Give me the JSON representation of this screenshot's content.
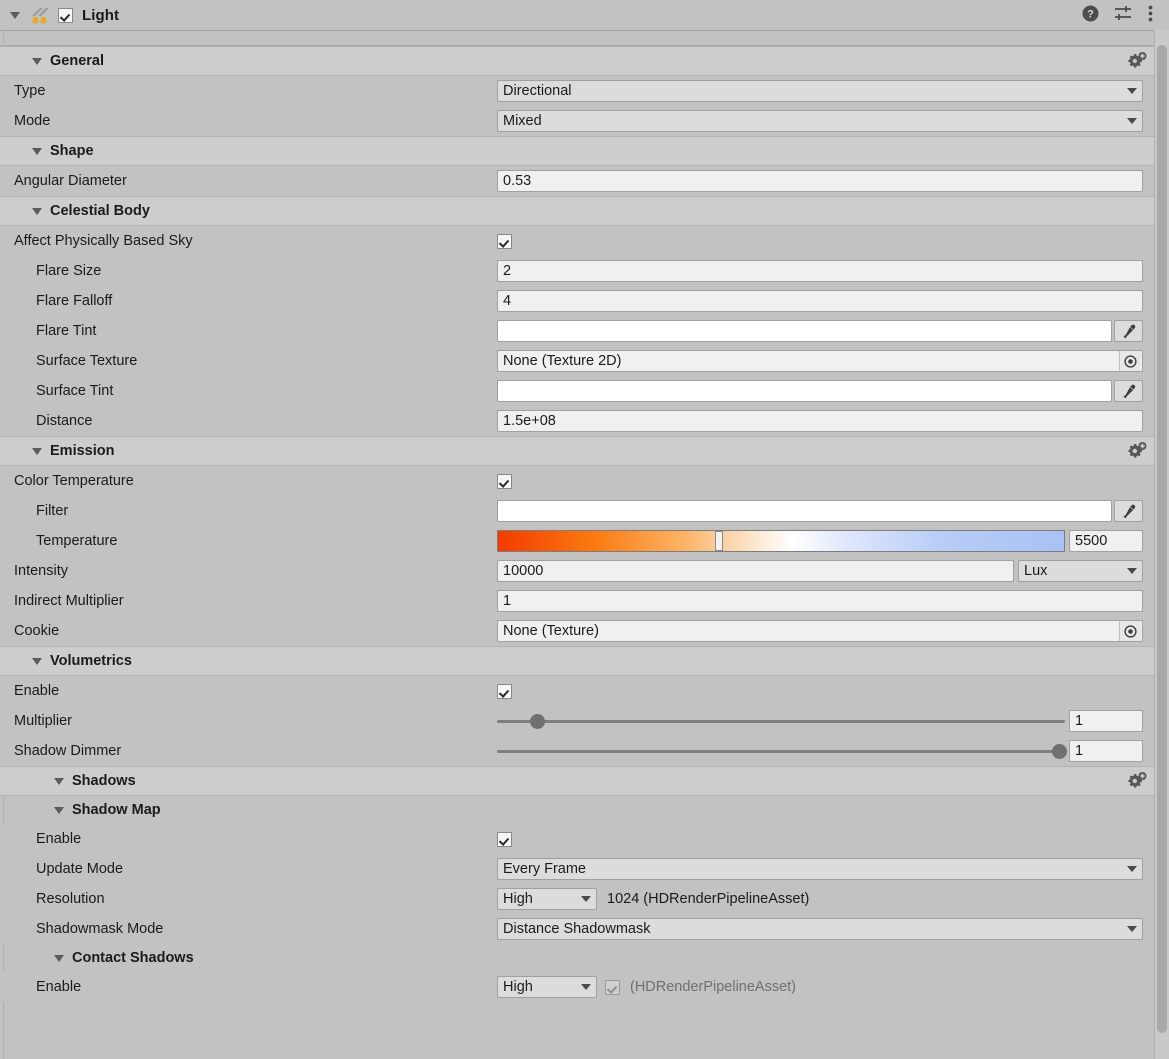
{
  "titlebar": {
    "title": "Light",
    "enabled_checkbox": true,
    "icons": [
      "help-icon",
      "preset-icon",
      "more-menu-icon"
    ]
  },
  "colors": {
    "panel_bg": "#c2c2c2",
    "section_header_bg": "#cdcdcd",
    "field_bg": "#f0f0f0",
    "dropdown_bg": "#dcdcdc",
    "temp_gradient_left": "#f23c00",
    "temp_gradient_right": "#a8c2f4",
    "muted_text": "#6f6f6f"
  },
  "sections": [
    {
      "name": "General",
      "label": "General",
      "has_gear": true,
      "rows": [
        {
          "label": "Type",
          "type": "dropdown",
          "value": "Directional"
        },
        {
          "label": "Mode",
          "type": "dropdown",
          "value": "Mixed"
        }
      ]
    },
    {
      "name": "Shape",
      "label": "Shape",
      "has_gear": false,
      "rows": [
        {
          "label": "Angular Diameter",
          "type": "text",
          "value": "0.53"
        }
      ]
    },
    {
      "name": "Celestial Body",
      "label": "Celestial Body",
      "has_gear": false,
      "rows": [
        {
          "label": "Affect Physically Based Sky",
          "type": "checkbox",
          "value": true
        },
        {
          "label": "Flare Size",
          "type": "text",
          "value": "2"
        },
        {
          "label": "Flare Falloff",
          "type": "text",
          "value": "4"
        },
        {
          "label": "Flare Tint",
          "type": "color",
          "value": "#ffffff"
        },
        {
          "label": "Surface Texture",
          "type": "object",
          "value": "None (Texture 2D)"
        },
        {
          "label": "Surface Tint",
          "type": "color",
          "value": "#ffffff"
        },
        {
          "label": "Distance",
          "type": "text",
          "value": "1.5e+08"
        }
      ]
    },
    {
      "name": "Emission",
      "label": "Emission",
      "has_gear": true,
      "rows": [
        {
          "label": "Color Temperature",
          "type": "checkbox",
          "value": true
        },
        {
          "label": "Filter",
          "type": "color",
          "value": "#ffffff"
        },
        {
          "label": "Temperature",
          "type": "gradient",
          "value": "5500",
          "handle_pct": 39
        },
        {
          "label": "Intensity",
          "type": "text_unit",
          "value": "10000",
          "unit": "Lux"
        },
        {
          "label": "Indirect Multiplier",
          "type": "text",
          "value": "1"
        },
        {
          "label": "Cookie",
          "type": "object",
          "value": "None (Texture)"
        }
      ]
    },
    {
      "name": "Volumetrics",
      "label": "Volumetrics",
      "has_gear": false,
      "rows": [
        {
          "label": "Enable",
          "type": "checkbox",
          "value": true
        },
        {
          "label": "Multiplier",
          "type": "slider",
          "value": "1",
          "knob_pct": 7
        },
        {
          "label": "Shadow Dimmer",
          "type": "slider",
          "value": "1",
          "knob_pct": 100
        }
      ]
    },
    {
      "name": "Shadows",
      "label": "Shadows",
      "has_gear": true,
      "subsections": [
        {
          "label": "Shadow Map",
          "rows": [
            {
              "label": "Enable",
              "type": "checkbox",
              "value": true
            },
            {
              "label": "Update Mode",
              "type": "dropdown",
              "value": "Every Frame"
            },
            {
              "label": "Resolution",
              "type": "dropdown_suffix",
              "value": "High",
              "suffix": "1024 (HDRenderPipelineAsset)"
            },
            {
              "label": "Shadowmask Mode",
              "type": "dropdown",
              "value": "Distance Shadowmask"
            }
          ]
        },
        {
          "label": "Contact Shadows",
          "rows": [
            {
              "label": "Enable",
              "type": "dropdown_check_suffix",
              "value": "High",
              "checked": true,
              "suffix": "(HDRenderPipelineAsset)"
            }
          ]
        }
      ]
    }
  ],
  "scrollbar": {
    "thumb_top_pct": 1.5,
    "thumb_height_pct": 96
  }
}
